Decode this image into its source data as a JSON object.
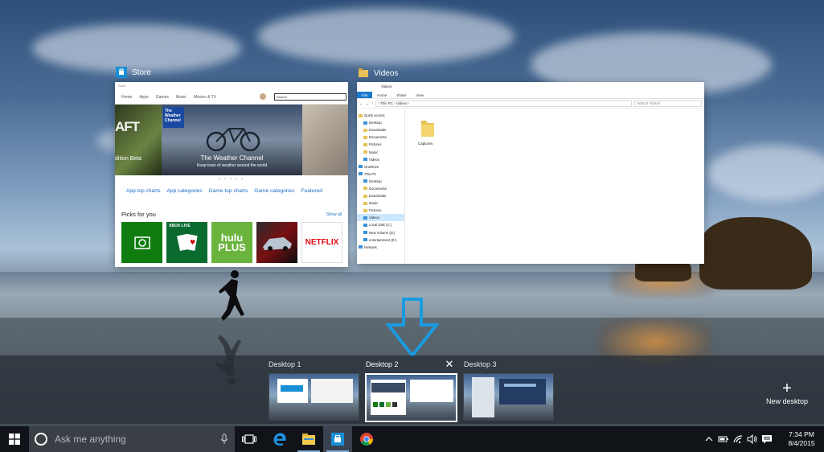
{
  "windows": {
    "store": {
      "label": "Store",
      "caption": "Store",
      "nav": [
        "Home",
        "Apps",
        "Games",
        "Music",
        "Movies & TV"
      ],
      "search_placeholder": "Search",
      "hero_left_big": "AFT",
      "hero_left_small": "dition Beta",
      "hero_brand": "The Weather Channel",
      "hero_title": "The Weather Channel",
      "hero_subtitle": "Keep track of weather around the world",
      "dots": "• • • • •",
      "links": [
        "App top charts",
        "App categories",
        "Game top charts",
        "Game categories",
        "Featured"
      ],
      "picks_title": "Picks for you",
      "show_all": "Show all",
      "tiles": [
        {
          "name": "xbox-tile",
          "label": "",
          "color": "#107c10"
        },
        {
          "name": "solitaire-tile",
          "label": "XBOX LIVE",
          "color": "#0b6b2f"
        },
        {
          "name": "hulu-tile",
          "label": "hulu PLUS",
          "color": "#6ab43e"
        },
        {
          "name": "asphalt-tile",
          "label": "",
          "color": "#1a1a1a"
        },
        {
          "name": "netflix-tile",
          "label": "NETFLIX",
          "color": "#ffffff"
        }
      ]
    },
    "videos": {
      "label": "Videos",
      "title": "Videos",
      "ribbon": [
        "File",
        "Home",
        "Share",
        "View"
      ],
      "address": "› This PC › Videos ›",
      "search_placeholder": "Search Videos",
      "nav_items": [
        {
          "text": "Quick access",
          "sel": false
        },
        {
          "text": "Desktop",
          "sel": false
        },
        {
          "text": "Downloads",
          "sel": false
        },
        {
          "text": "Documents",
          "sel": false
        },
        {
          "text": "Pictures",
          "sel": false
        },
        {
          "text": "Music",
          "sel": false
        },
        {
          "text": "Videos",
          "sel": false
        },
        {
          "text": "OneDrive",
          "sel": false
        },
        {
          "text": "This PC",
          "sel": false
        },
        {
          "text": "Desktop",
          "sel": false
        },
        {
          "text": "Documents",
          "sel": false
        },
        {
          "text": "Downloads",
          "sel": false
        },
        {
          "text": "Music",
          "sel": false
        },
        {
          "text": "Pictures",
          "sel": false
        },
        {
          "text": "Videos",
          "sel": true
        },
        {
          "text": "Local Disk (C:)",
          "sel": false
        },
        {
          "text": "New Volume (D:)",
          "sel": false
        },
        {
          "text": "entertainment (E:)",
          "sel": false
        },
        {
          "text": "Network",
          "sel": false
        }
      ],
      "folder_label": "Captures"
    }
  },
  "desktops": [
    {
      "label": "Desktop 1",
      "active": false
    },
    {
      "label": "Desktop 2",
      "active": true
    },
    {
      "label": "Desktop 3",
      "active": false
    }
  ],
  "close_glyph": "✕",
  "new_desktop": {
    "plus": "+",
    "label": "New desktop"
  },
  "taskbar": {
    "search_placeholder": "Ask me anything",
    "apps": [
      "task-view",
      "edge",
      "file-explorer",
      "store",
      "chrome"
    ]
  },
  "clock": {
    "time": "7:34 PM",
    "date": "8/4/2015"
  },
  "colors": {
    "accent": "#1a8fd6",
    "taskbar": "#101418",
    "strip": "rgba(38,44,52,0.72)"
  }
}
